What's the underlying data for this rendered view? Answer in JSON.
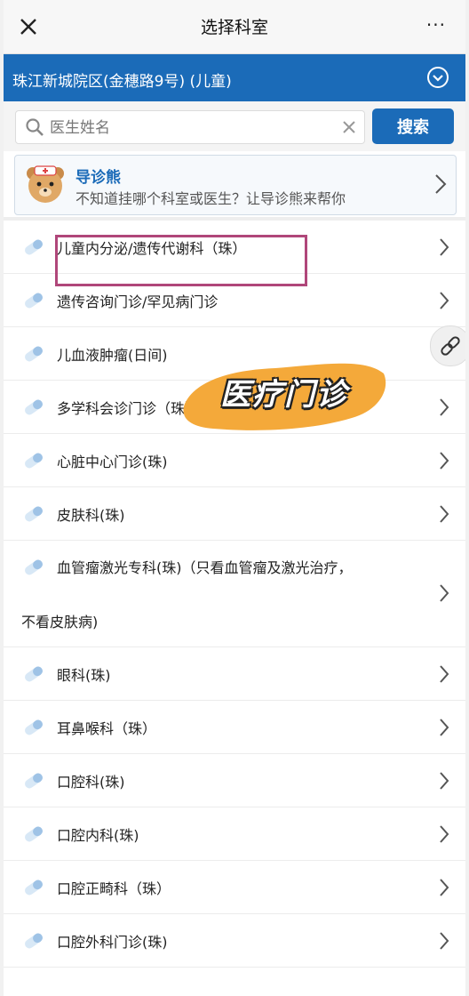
{
  "header": {
    "title": "选择科室",
    "more": "···"
  },
  "hospital": {
    "name": "珠江新城院区(金穗路9号) (儿童)"
  },
  "search": {
    "placeholder": "医生姓名",
    "button": "搜索"
  },
  "guide": {
    "title": "导诊熊",
    "subtitle": "不知道挂哪个科室或医生？让导诊熊来帮你"
  },
  "departments": [
    {
      "label": "儿童内分泌/遗传代谢科（珠）"
    },
    {
      "label": "遗传咨询门诊/罕见病门诊"
    },
    {
      "label": "儿血液肿瘤(日间)"
    },
    {
      "label": "多学科会诊门诊（珠）"
    },
    {
      "label": "心脏中心门诊(珠)"
    },
    {
      "label": "皮肤科(珠)"
    },
    {
      "label": "血管瘤激光专科(珠)（只看血管瘤及激光治疗，不看皮肤病)"
    },
    {
      "label": "眼科(珠)"
    },
    {
      "label": "耳鼻喉科（珠）"
    },
    {
      "label": "口腔科(珠)"
    },
    {
      "label": "口腔内科(珠)"
    },
    {
      "label": "口腔正畸科（珠）"
    },
    {
      "label": "口腔外科门诊(珠)"
    }
  ],
  "overlay": {
    "stamp_text": "医疗门诊"
  },
  "colors": {
    "brand_blue": "#1b6bb8",
    "highlight": "#b0477a",
    "brush": "#f4a93a"
  }
}
